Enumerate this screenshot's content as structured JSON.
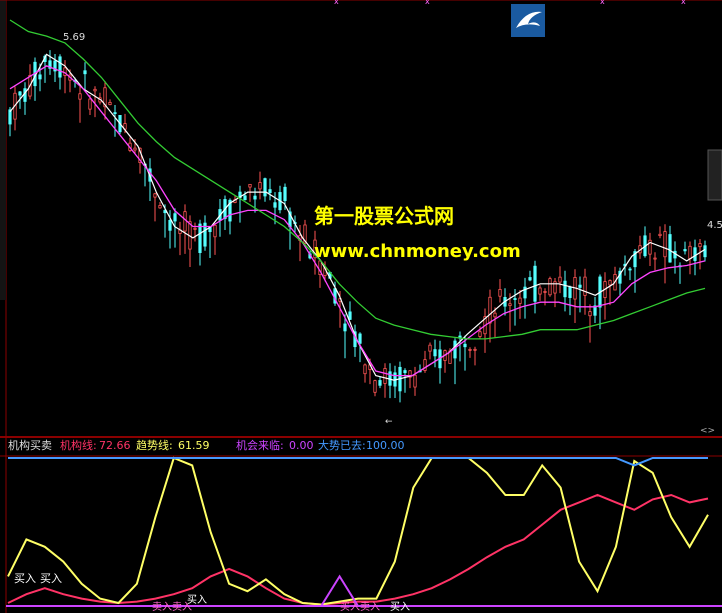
{
  "watermark": {
    "line1": "第一股票公式网",
    "line2": "www.chnmoney.com",
    "color": "#FFFF00"
  },
  "price_panel": {
    "high_label": "5.69",
    "right_label": "4.5",
    "low_marker": "←",
    "colors": {
      "up": "#FF5555",
      "down": "#55FFFF",
      "white_line": "#FFFFFF",
      "magenta_line": "#FF44FF",
      "green_line": "#33CC33"
    }
  },
  "indicator_header": {
    "name": "机构买卖",
    "items": [
      {
        "label": "机构线:",
        "value": "72.66",
        "color": "#FF3366"
      },
      {
        "label": "趋势线:",
        "value": "61.59",
        "color": "#FFFF66"
      },
      {
        "label": "机会来临:",
        "value": "0.00",
        "color": "#CC44FF"
      },
      {
        "label": "大势已去:",
        "value": "100.00",
        "color": "#4499FF"
      }
    ]
  },
  "signal_labels": [
    "买入",
    "买入",
    "买入",
    "买入",
    "卖入卖入",
    "买入卖入"
  ],
  "chart_data": [
    {
      "type": "line",
      "title": "",
      "note": "candlestick price chart with moving averages",
      "ylim": [
        4.05,
        5.75
      ],
      "series": [
        {
          "name": "",
          "color": "#FFFFFF",
          "values": [
            5.35,
            5.45,
            5.6,
            5.55,
            5.45,
            5.4,
            5.3,
            5.2,
            5.0,
            4.85,
            4.8,
            4.85,
            4.95,
            5.0,
            5.0,
            4.95,
            4.8,
            4.7,
            4.55,
            4.35,
            4.2,
            4.18,
            4.2,
            4.25,
            4.3,
            4.38,
            4.45,
            4.52,
            4.57,
            4.6,
            4.6,
            4.58,
            4.55,
            4.6,
            4.72,
            4.78,
            4.75,
            4.7,
            4.75
          ]
        },
        {
          "name": "",
          "color": "#FF44FF",
          "values": [
            5.45,
            5.5,
            5.55,
            5.52,
            5.45,
            5.35,
            5.25,
            5.15,
            5.05,
            4.92,
            4.85,
            4.85,
            4.9,
            4.92,
            4.92,
            4.88,
            4.78,
            4.65,
            4.5,
            4.35,
            4.22,
            4.2,
            4.2,
            4.25,
            4.3,
            4.36,
            4.42,
            4.47,
            4.5,
            4.52,
            4.52,
            4.5,
            4.5,
            4.52,
            4.6,
            4.65,
            4.67,
            4.68,
            4.7
          ]
        },
        {
          "name": "",
          "color": "#33CC33",
          "values": [
            5.75,
            5.7,
            5.68,
            5.65,
            5.58,
            5.5,
            5.4,
            5.3,
            5.22,
            5.15,
            5.1,
            5.05,
            5.0,
            4.95,
            4.9,
            4.85,
            4.78,
            4.7,
            4.6,
            4.52,
            4.45,
            4.42,
            4.4,
            4.38,
            4.37,
            4.36,
            4.36,
            4.37,
            4.38,
            4.4,
            4.4,
            4.4,
            4.42,
            4.44,
            4.47,
            4.5,
            4.53,
            4.56,
            4.58
          ]
        }
      ]
    },
    {
      "type": "line",
      "title": "机构买卖",
      "ylim": [
        0,
        100
      ],
      "series": [
        {
          "name": "机构线",
          "color": "#FF3366",
          "values": [
            2,
            8,
            12,
            8,
            5,
            3,
            2,
            3,
            5,
            8,
            12,
            20,
            25,
            20,
            12,
            5,
            2,
            1,
            2,
            3,
            3,
            5,
            8,
            12,
            18,
            25,
            33,
            40,
            45,
            55,
            65,
            70,
            75,
            70,
            65,
            72,
            75,
            70,
            72.66
          ]
        },
        {
          "name": "趋势线",
          "color": "#FFFF66",
          "values": [
            20,
            45,
            40,
            30,
            15,
            5,
            2,
            15,
            60,
            100,
            95,
            50,
            15,
            10,
            18,
            8,
            2,
            1,
            3,
            5,
            5,
            30,
            80,
            100,
            100,
            100,
            90,
            75,
            75,
            95,
            80,
            30,
            10,
            40,
            98,
            90,
            60,
            40,
            61.59
          ]
        },
        {
          "name": "机会来临",
          "color": "#CC44FF",
          "values": [
            0,
            0,
            0,
            0,
            0,
            0,
            0,
            0,
            0,
            0,
            0,
            0,
            0,
            0,
            0,
            0,
            0,
            0,
            20,
            0,
            0,
            0,
            0,
            0,
            0,
            0,
            0,
            0,
            0,
            0,
            0,
            0,
            0,
            0,
            0,
            0,
            0,
            0,
            0.0
          ]
        },
        {
          "name": "大势已去",
          "color": "#4499FF",
          "values": [
            100,
            100,
            100,
            100,
            100,
            100,
            100,
            100,
            100,
            100,
            100,
            100,
            100,
            100,
            100,
            100,
            100,
            100,
            100,
            100,
            100,
            100,
            100,
            100,
            100,
            100,
            100,
            100,
            100,
            100,
            100,
            100,
            100,
            100,
            95,
            100,
            100,
            100,
            100.0
          ]
        }
      ]
    }
  ]
}
